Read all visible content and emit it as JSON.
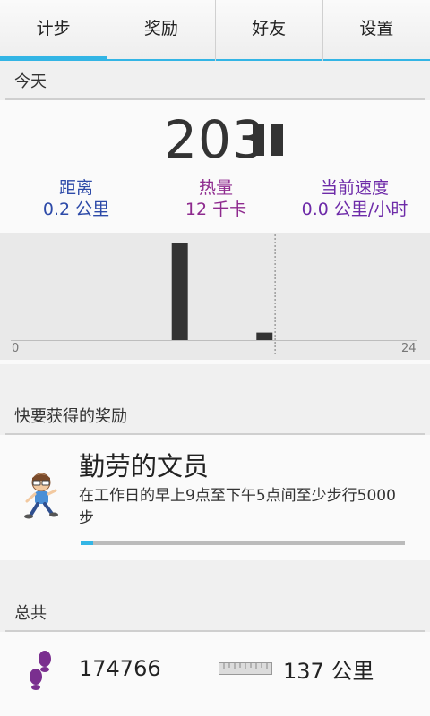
{
  "tabs": [
    {
      "label": "计步",
      "active": true
    },
    {
      "label": "奖励",
      "active": false
    },
    {
      "label": "好友",
      "active": false
    },
    {
      "label": "设置",
      "active": false
    }
  ],
  "today": {
    "header": "今天",
    "steps": "203",
    "pause_icon": "pause-icon",
    "distance": {
      "label": "距离",
      "value": "0.2 公里"
    },
    "calories": {
      "label": "热量",
      "value": "12 千卡"
    },
    "speed": {
      "label": "当前速度",
      "value": "0.0 公里/小时"
    }
  },
  "chart_data": {
    "type": "bar",
    "x_min_label": "0",
    "x_max_label": "24",
    "xlim": [
      0,
      24
    ],
    "bars": [
      {
        "hour": 10,
        "value": 180
      },
      {
        "hour": 15,
        "value": 14
      }
    ],
    "ylim": [
      0,
      200
    ],
    "current_hour": 15.6,
    "bar_color": "#333333"
  },
  "rewards": {
    "header": "快要获得的奖励",
    "title": "勤劳的文员",
    "description": "在工作日的早上9点至下午5点间至少步行5000步",
    "progress": 0.04,
    "icon": "runner-icon"
  },
  "totals": {
    "header": "总共",
    "steps": "174766",
    "distance": "137 公里",
    "steps_icon": "footprints-icon",
    "distance_icon": "ruler-icon"
  },
  "colors": {
    "accent": "#33b5e5",
    "distance": "#2d4aa8",
    "calories": "#8e2a8e",
    "speed": "#6d2aa8"
  }
}
